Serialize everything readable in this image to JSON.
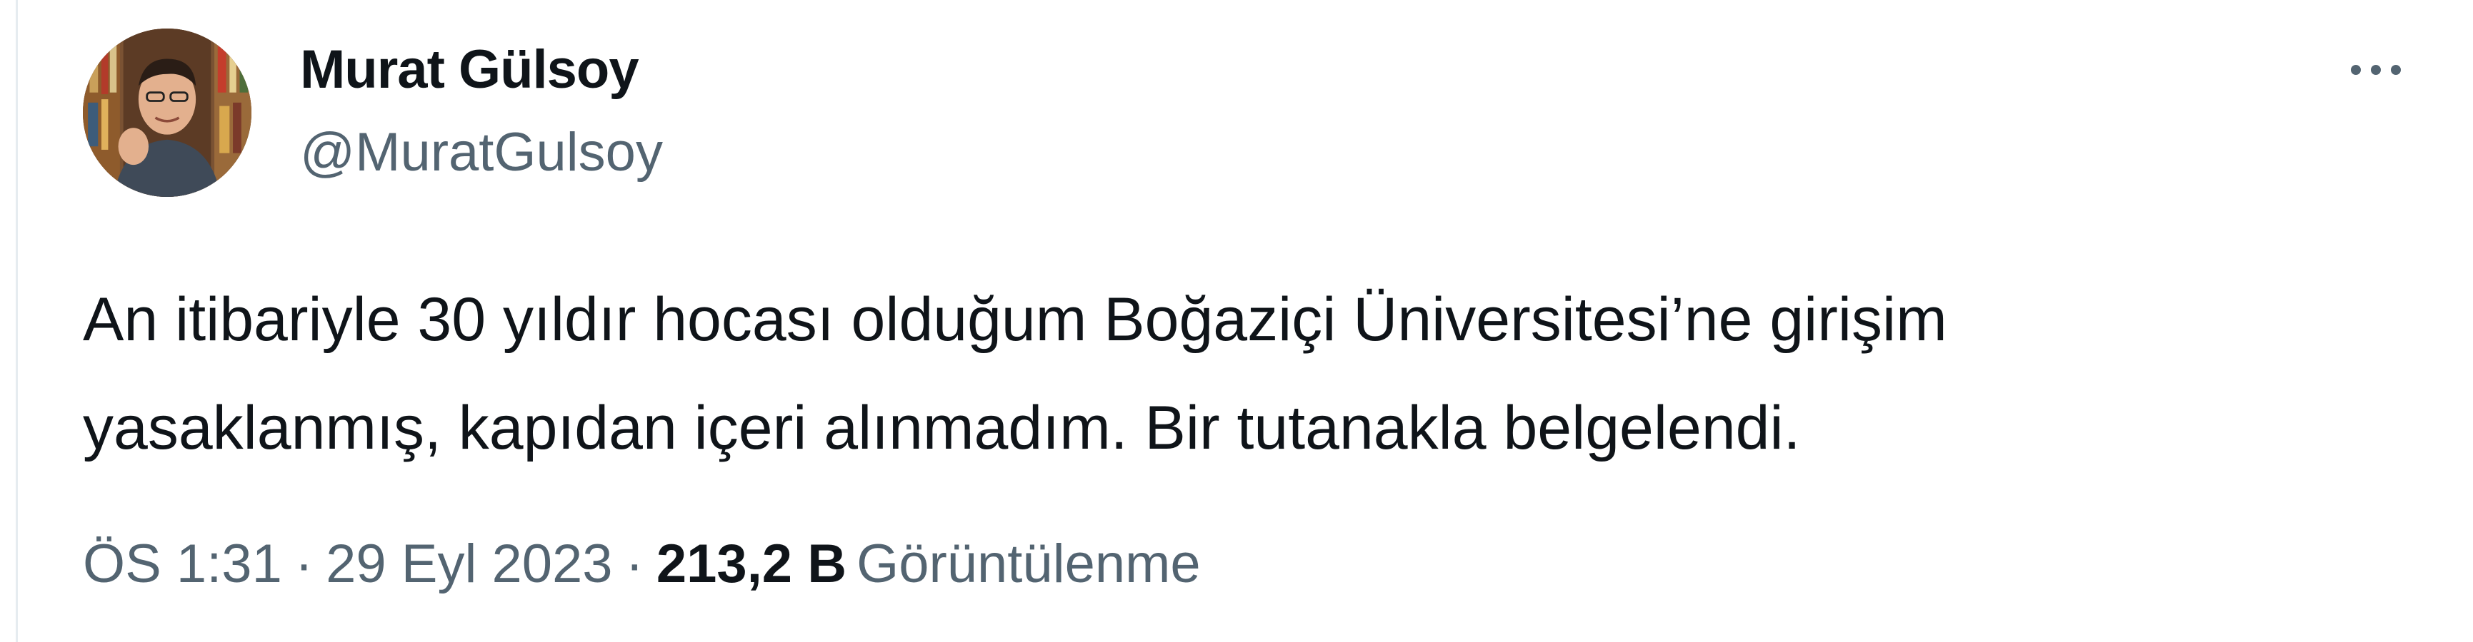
{
  "tweet": {
    "author": {
      "display_name": "Murat Gülsoy",
      "handle": "@MuratGulsoy",
      "avatar_icon": "profile-photo"
    },
    "more_icon": "ellipsis-icon",
    "text_lines": [
      "An itibariyle 30 yıldır hocası olduğum Boğaziçi Üniversitesi’ne girişim",
      "yasaklanmış, kapıdan içeri alınmadım. Bir tutanakla belgelendi."
    ],
    "meta": {
      "time": "ÖS 1:31",
      "separator": "·",
      "date": "29 Eyl 2023",
      "views_count": "213,2 B",
      "views_label": "Görüntülenme"
    }
  },
  "colors": {
    "text_primary": "#0f1419",
    "text_secondary": "#536471",
    "border": "#e6ecf0",
    "background": "#ffffff"
  }
}
